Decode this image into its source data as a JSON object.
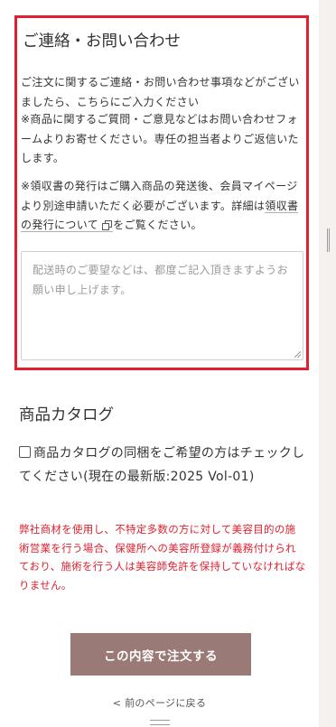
{
  "contact": {
    "title": "ご連絡・お問い合わせ",
    "paragraph1": "ご注文に関するご連絡・お問い合わせ事項などがございましたら、こちらにご入力ください",
    "paragraph2": "※商品に関するご質問・ご意見などはお問い合わせフォームよりお寄せください。専任の担当者よりご返信いたします。",
    "paragraph3_before": "※領収書の発行はご購入商品の発送後、会員マイページより別途申請いただく必要がございます。詳細は",
    "paragraph3_link": "領収書の発行について",
    "paragraph3_after": "をご覧ください。",
    "textarea_placeholder": "配送時のご要望などは、都度ご記入頂きますようお願い申し上げます。"
  },
  "catalog": {
    "title": "商品カタログ",
    "checkbox_label": "商品カタログの同梱をご希望の方はチェックしてください(現在の最新版:2025 Vol-01)",
    "checked": false
  },
  "notice": "弊社商材を使用し、不特定多数の方に対して美容目的の施術営業を行う場合、保健所への美容所登録が義務付けられており、施術を行う人は美容師免許を保持していなければなりません。",
  "actions": {
    "submit_label": "この内容で注文する",
    "back_label": "< 前のページに戻る"
  },
  "icons": {
    "external_link": "external-link-icon",
    "scroll_grip": "drag-handle-icon"
  },
  "colors": {
    "highlight_border": "#e0202f",
    "notice_text": "#e0202f",
    "button_bg": "#9a7a76",
    "side_bg": "#f6f1ef"
  }
}
